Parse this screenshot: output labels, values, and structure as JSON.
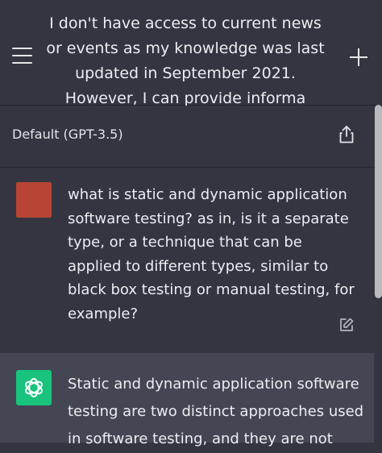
{
  "header": {
    "title": "I don't have access to current news or events as my knowledge was last updated in September 2021. However, I can provide informa"
  },
  "model": {
    "label": "Default (GPT-3.5)"
  },
  "conversation": {
    "user_message": "what is static and dynamic application software testing? as in, is it a separate type, or a technique that can be applied to different types, similar to black box testing or manual testing, for example?",
    "assistant_message": "Static and dynamic application software testing are two distinct approaches used in software testing, and they are not"
  },
  "icons": {
    "menu": "hamburger-menu-icon",
    "new_chat": "plus-icon",
    "share": "share-icon",
    "edit": "edit-icon",
    "assistant_avatar": "openai-logo-icon"
  },
  "colors": {
    "background": "#343541",
    "assistant_background": "#444654",
    "user_avatar": "#b84534",
    "assistant_avatar": "#19c37d"
  }
}
